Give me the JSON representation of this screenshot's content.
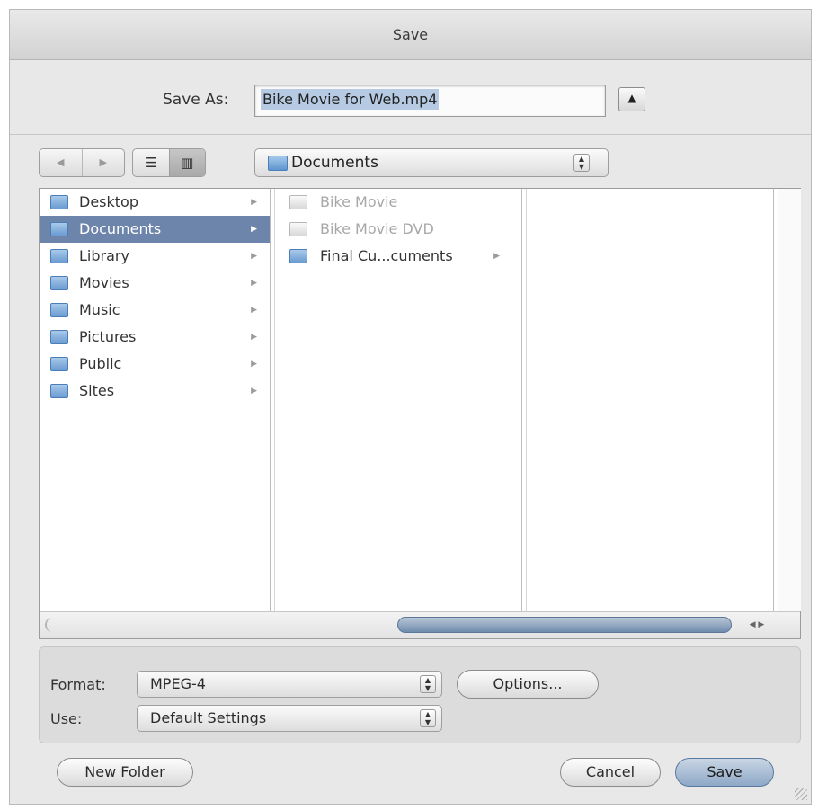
{
  "window": {
    "title": "Save"
  },
  "save_as": {
    "label": "Save As:",
    "value": "Bike Movie for Web.mp4",
    "expand_glyph": "▲"
  },
  "toolbar": {
    "back_glyph": "◀",
    "forward_glyph": "▶",
    "list_view_glyph": "☰",
    "column_view_glyph": "▥",
    "location": "Documents",
    "location_arrows": "▲▼"
  },
  "browser": {
    "column1": [
      {
        "label": "Desktop",
        "icon": "desktop-folder-icon",
        "arrow": "▶"
      },
      {
        "label": "Documents",
        "icon": "documents-folder-icon",
        "arrow": "▶",
        "selected": true
      },
      {
        "label": "Library",
        "icon": "library-folder-icon",
        "arrow": "▶"
      },
      {
        "label": "Movies",
        "icon": "movies-folder-icon",
        "arrow": "▶"
      },
      {
        "label": "Music",
        "icon": "music-folder-icon",
        "arrow": "▶"
      },
      {
        "label": "Pictures",
        "icon": "pictures-folder-icon",
        "arrow": "▶"
      },
      {
        "label": "Public",
        "icon": "public-folder-icon",
        "arrow": "▶"
      },
      {
        "label": "Sites",
        "icon": "sites-folder-icon",
        "arrow": "▶"
      }
    ],
    "column2": [
      {
        "label": "Bike Movie",
        "icon": "document-icon",
        "dim": true
      },
      {
        "label": "Bike Movie DVD",
        "icon": "document-icon",
        "dim": true
      },
      {
        "label": "Final Cu...cuments",
        "icon": "folder-icon",
        "arrow": "▶"
      }
    ],
    "scroll_arrows": "◀ ▶"
  },
  "options": {
    "format_label": "Format:",
    "format_value": "MPEG-4",
    "options_button": "Options...",
    "use_label": "Use:",
    "use_value": "Default Settings",
    "popup_arrows": "▲▼"
  },
  "footer": {
    "new_folder": "New Folder",
    "cancel": "Cancel",
    "save": "Save"
  },
  "colors": {
    "selection": "#6d84ab",
    "default_button": "#8ea8c7"
  }
}
